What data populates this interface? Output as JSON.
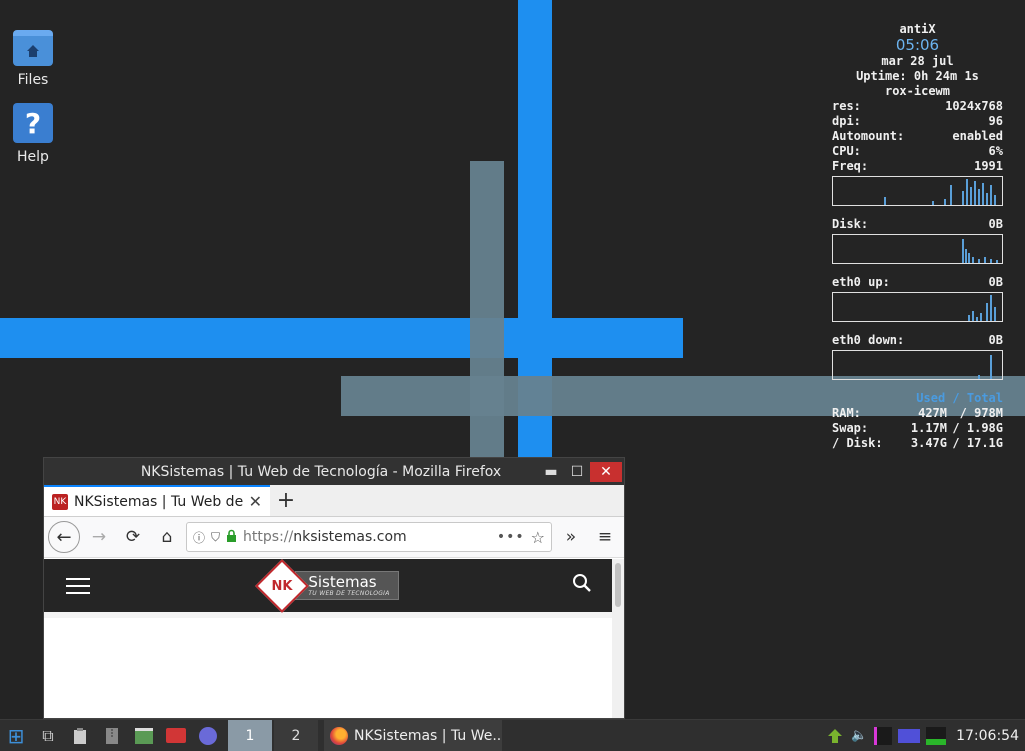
{
  "desktop": {
    "icons": [
      {
        "label": "Files",
        "icon": "folder-icon"
      },
      {
        "label": "Help",
        "icon": "help-icon",
        "glyph": "?"
      }
    ],
    "colors": {
      "background": "#242424",
      "stripe_blue": "#1e8ff0",
      "stripe_gray": "#66828f"
    }
  },
  "conky": {
    "host": "antiX",
    "time": "05:06",
    "date": "mar 28 jul",
    "uptime": "Uptime: 0h 24m 1s",
    "wm": "rox-icewm",
    "stats": [
      {
        "label": "res:",
        "value": "1024x768"
      },
      {
        "label": "dpi:",
        "value": "96"
      },
      {
        "label": "Automount:",
        "value": "enabled"
      },
      {
        "label": "CPU:",
        "value": "6%"
      },
      {
        "label": "Freq:",
        "value": "1991"
      }
    ],
    "disk": {
      "label": "Disk:",
      "value": "0B"
    },
    "eth_up": {
      "label": "eth0 up:",
      "value": "0B"
    },
    "eth_down": {
      "label": "eth0 down:",
      "value": "0B"
    },
    "mem_header": "Used / Total",
    "mem": [
      {
        "label": "RAM:",
        "used": "427M",
        "total": "/ 978M"
      },
      {
        "label": "Swap:",
        "used": "1.17M",
        "total": "/ 1.98G"
      },
      {
        "label": "/ Disk:",
        "used": "3.47G",
        "total": "/ 17.1G"
      }
    ]
  },
  "firefox": {
    "window_title": "NKSistemas | Tu Web de Tecnología - Mozilla Firefox",
    "controls": {
      "minimize": "▬",
      "maximize": "☐",
      "close": "✕"
    },
    "tab": {
      "label": "NKSistemas | Tu Web de Te",
      "close": "✕",
      "favicon": "NK"
    },
    "new_tab": "+",
    "nav": {
      "back": "←",
      "forward": "→",
      "reload": "⟳",
      "home": "⌂",
      "overflow": "»",
      "menu": "≡"
    },
    "url": {
      "scheme": "https://",
      "host": "nksistemas.com",
      "more": "•••",
      "bookmark": "☆",
      "info": "ⓘ",
      "tracking": "⛉",
      "lock": "🔒"
    },
    "site": {
      "logo_mark": "NK",
      "brand": "Sistemas",
      "tagline": "TU WEB DE TECNOLOGIA",
      "search": "⌕"
    }
  },
  "taskbar": {
    "workspaces": [
      "1",
      "2"
    ],
    "task_label": "NKSistemas | Tu We...",
    "clock": "17:06:54",
    "icons": {
      "start": "⊞",
      "show_desktop": "⧉",
      "volume": "🔈"
    }
  }
}
